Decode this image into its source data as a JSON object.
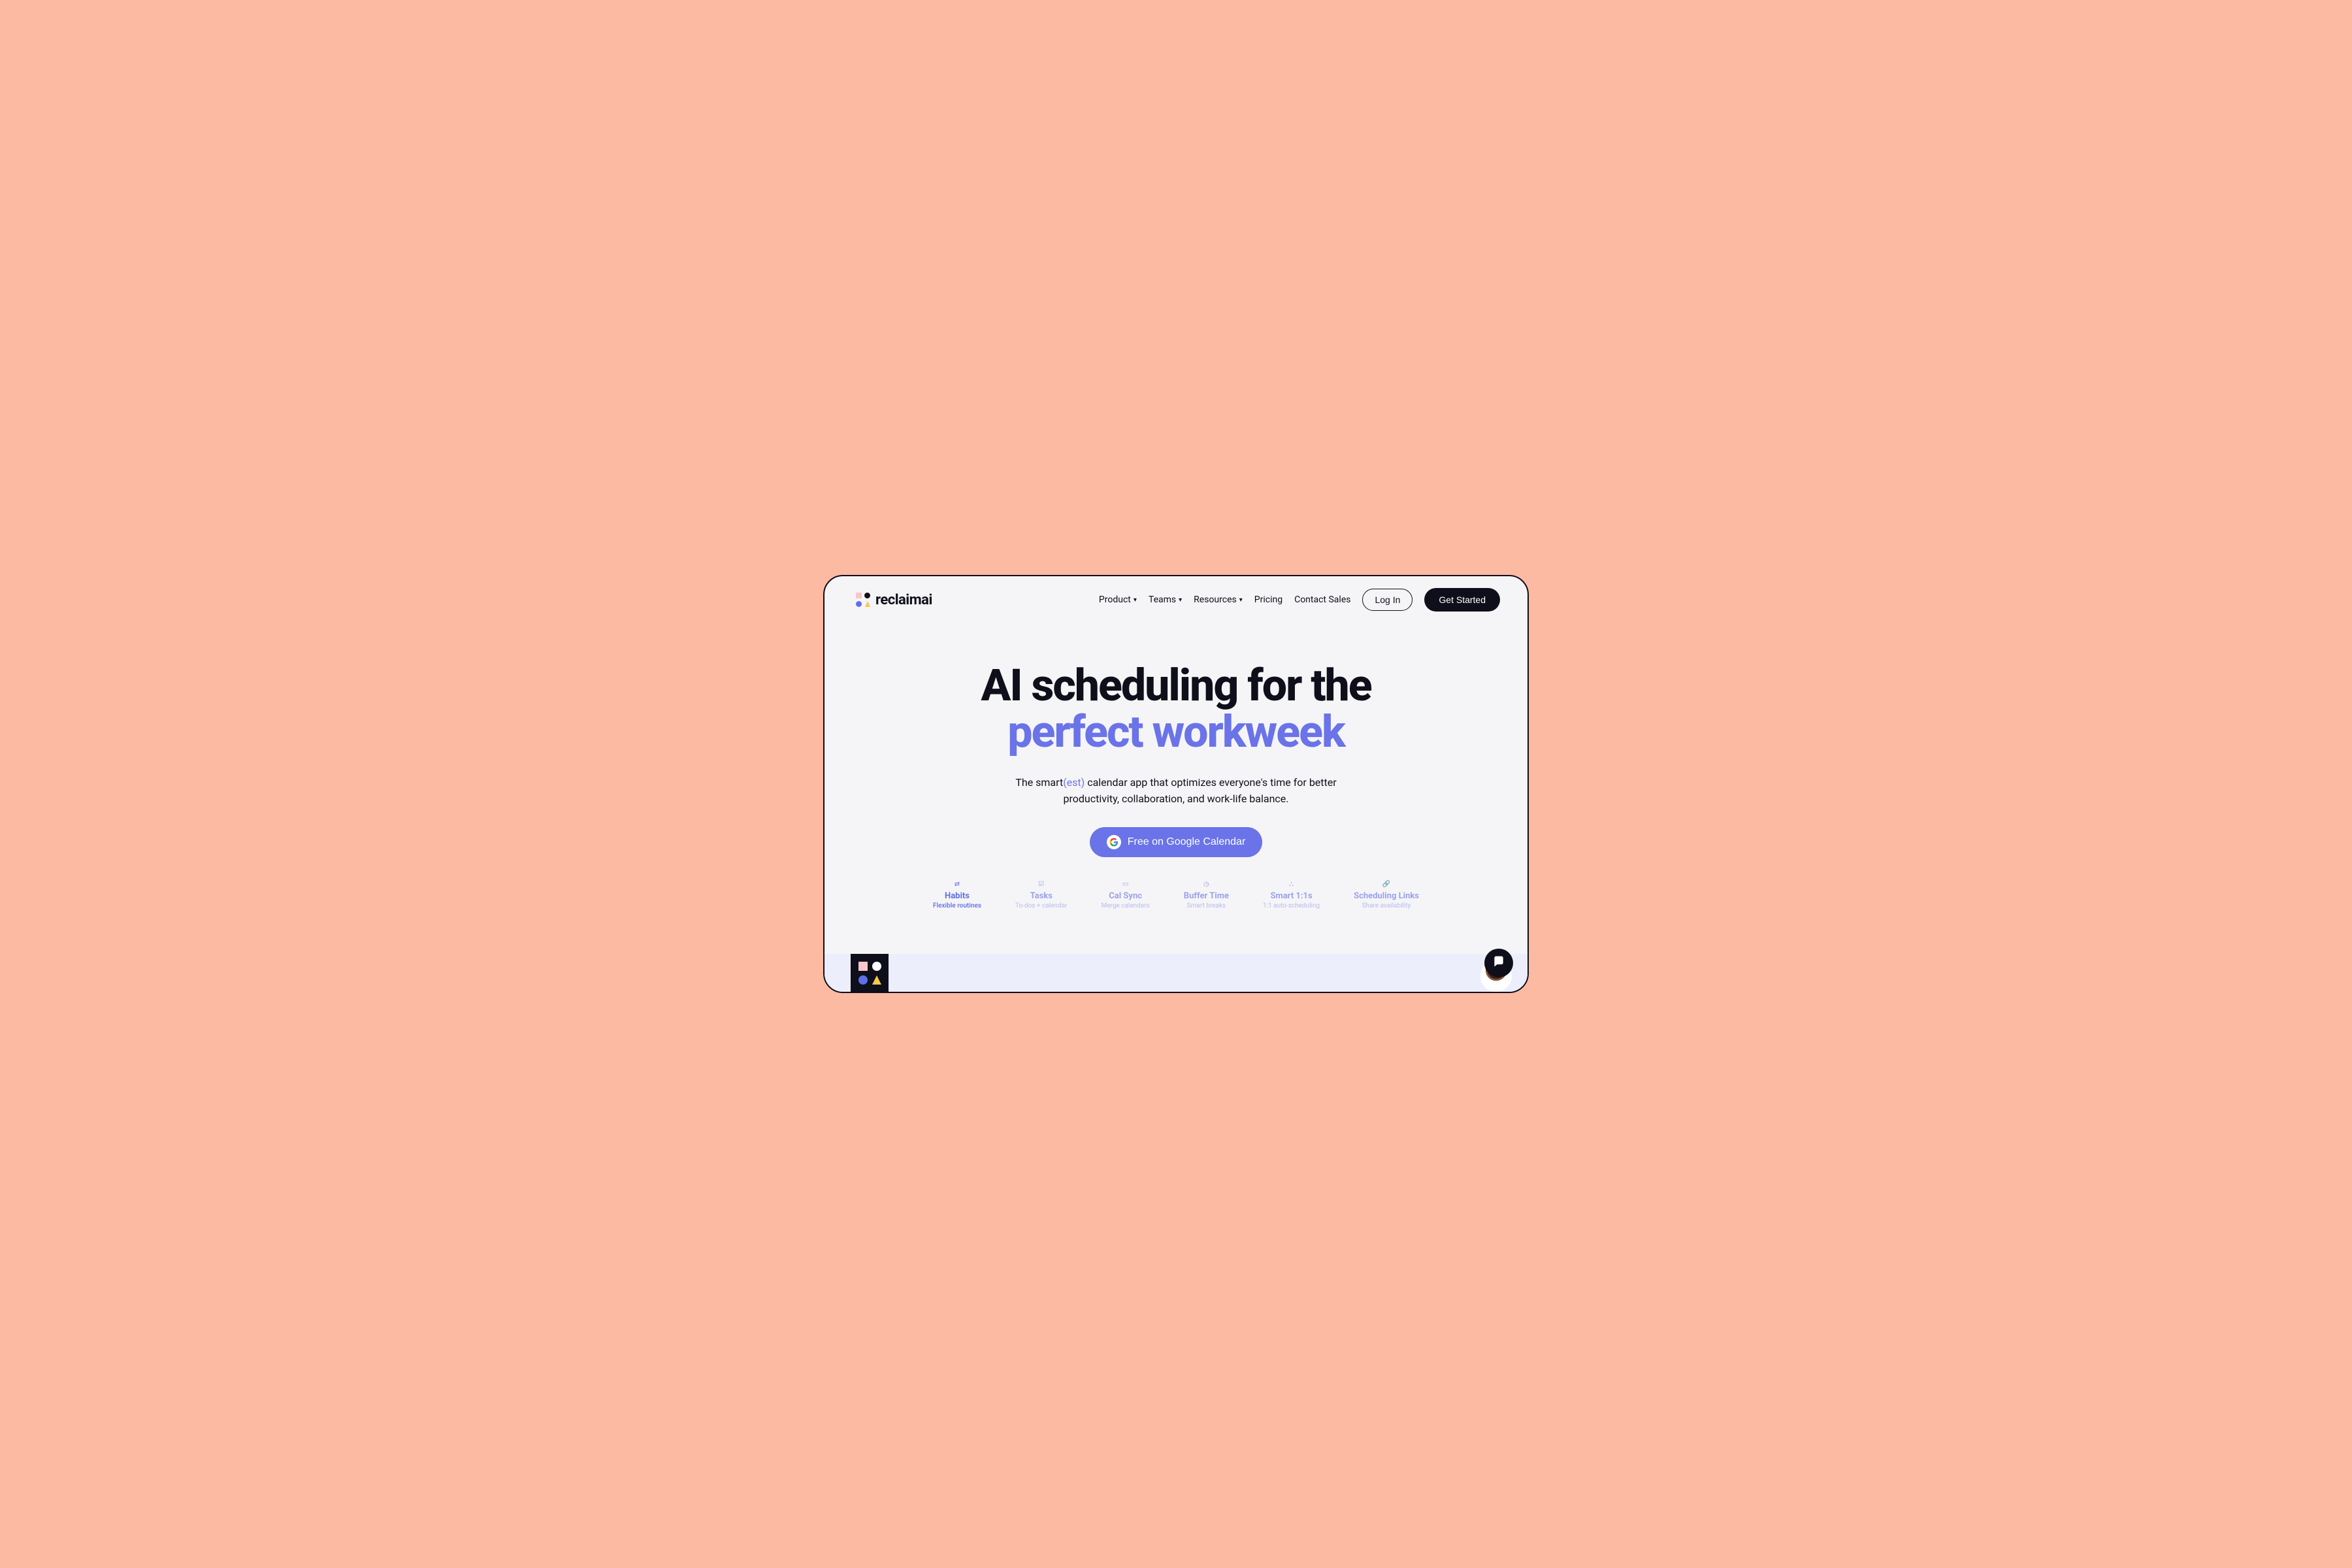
{
  "brand": {
    "name": "reclaimai"
  },
  "nav": {
    "items": [
      {
        "label": "Product",
        "dropdown": true
      },
      {
        "label": "Teams",
        "dropdown": true
      },
      {
        "label": "Resources",
        "dropdown": true
      },
      {
        "label": "Pricing",
        "dropdown": false
      },
      {
        "label": "Contact Sales",
        "dropdown": false
      }
    ],
    "login": "Log In",
    "cta": "Get Started"
  },
  "hero": {
    "headline_line1": "AI scheduling for the",
    "headline_line2": "perfect workweek",
    "sub_pre": "The smart",
    "sub_paren": "(est)",
    "sub_post": " calendar app that optimizes everyone's time for better productivity, collaboration, and work-life balance.",
    "cta_label": "Free on Google Calendar"
  },
  "features": [
    {
      "icon": "repeat-icon",
      "title": "Habits",
      "sub": "Flexible routines",
      "active": true
    },
    {
      "icon": "check-icon",
      "title": "Tasks",
      "sub": "To-dos + calendar",
      "active": false
    },
    {
      "icon": "calendar-icon",
      "title": "Cal Sync",
      "sub": "Merge calendars",
      "active": false
    },
    {
      "icon": "clock-icon",
      "title": "Buffer Time",
      "sub": "Smart breaks",
      "active": false
    },
    {
      "icon": "people-icon",
      "title": "Smart 1:1s",
      "sub": "1:1 auto-scheduling",
      "active": false
    },
    {
      "icon": "link-icon",
      "title": "Scheduling Links",
      "sub": "Share availability",
      "active": false
    }
  ],
  "colors": {
    "bg_outer": "#fcbaa2",
    "bg_page": "#f5f5f7",
    "ink": "#0e0f1a",
    "accent": "#6a73e8",
    "accent_muted": "#9aa2ee",
    "strip": "#eceefb"
  }
}
